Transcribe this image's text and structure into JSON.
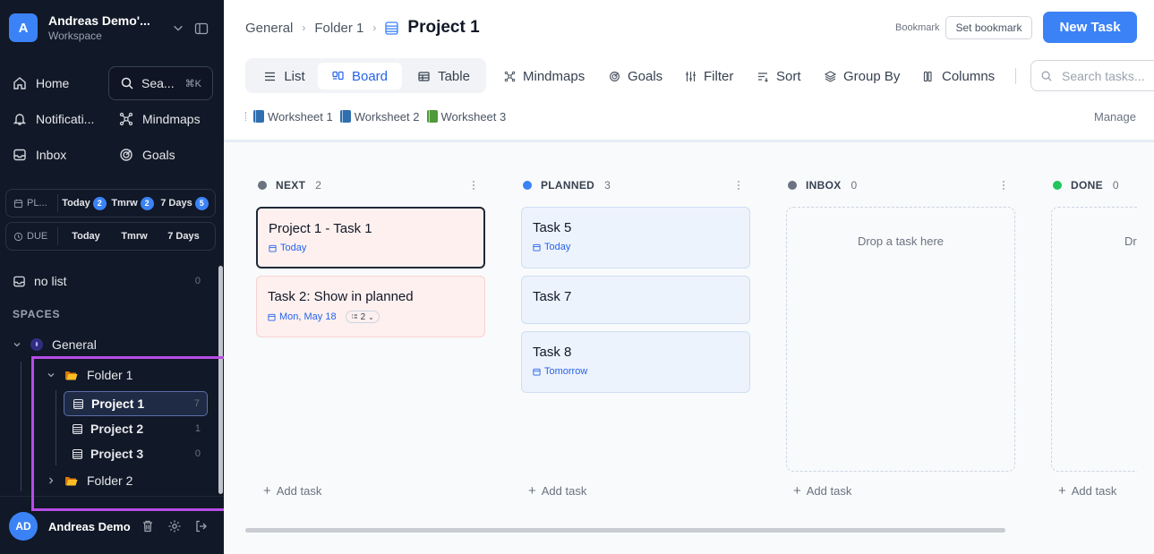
{
  "workspace": {
    "avatar": "A",
    "name": "Andreas Demo'...",
    "subtitle": "Workspace"
  },
  "nav": {
    "home": "Home",
    "search": "Sea...",
    "search_kbd": "⌘K",
    "notifications": "Notificati...",
    "mindmaps": "Mindmaps",
    "inbox": "Inbox",
    "goals": "Goals"
  },
  "planned_row": {
    "label": "PL...",
    "today": "Today",
    "today_count": "2",
    "tmrw": "Tmrw",
    "tmrw_count": "2",
    "week": "7 Days",
    "week_count": "5"
  },
  "due_row": {
    "label": "DUE",
    "today": "Today",
    "tmrw": "Tmrw",
    "week": "7 Days"
  },
  "no_list": {
    "label": "no list",
    "count": "0"
  },
  "spaces_heading": "SPACES",
  "tree": {
    "space": "General",
    "folder1": "Folder 1",
    "projects": [
      {
        "name": "Project 1",
        "count": "7"
      },
      {
        "name": "Project 2",
        "count": "1"
      },
      {
        "name": "Project 3",
        "count": "0"
      }
    ],
    "folder2": "Folder 2"
  },
  "user": {
    "initials": "AD",
    "name": "Andreas Demo"
  },
  "breadcrumb": {
    "space": "General",
    "folder": "Folder 1",
    "current": "Project 1"
  },
  "bookmark": {
    "label": "Bookmark",
    "button": "Set bookmark"
  },
  "new_task": "New Task",
  "views": {
    "list": "List",
    "board": "Board",
    "table": "Table"
  },
  "toolbar": {
    "mindmaps": "Mindmaps",
    "goals": "Goals",
    "filter": "Filter",
    "sort": "Sort",
    "group_by": "Group By",
    "columns": "Columns",
    "search_placeholder": "Search tasks..."
  },
  "worksheets": [
    {
      "name": "Worksheet 1",
      "color": "#2f6fb0"
    },
    {
      "name": "Worksheet 2",
      "color": "#2f6fb0"
    },
    {
      "name": "Worksheet 3",
      "color": "#4f9a3b"
    }
  ],
  "manage": "Manage",
  "columns": [
    {
      "name": "NEXT",
      "count": "2",
      "color": "#6b7280",
      "add": "Add task"
    },
    {
      "name": "PLANNED",
      "count": "3",
      "color": "#3b82f6",
      "add": "Add task"
    },
    {
      "name": "INBOX",
      "count": "0",
      "color": "#6b7280",
      "add": "Add task",
      "drop": "Drop a task here"
    },
    {
      "name": "DONE",
      "count": "0",
      "color": "#22c55e",
      "add": "Add task",
      "drop": "Dro"
    }
  ],
  "cards": {
    "next": [
      {
        "title": "Project 1 - Task 1",
        "date": "Today"
      },
      {
        "title": "Task 2: Show in planned",
        "date": "Mon, May 18",
        "subtasks": "2"
      }
    ],
    "planned": [
      {
        "title": "Task 5",
        "date": "Today"
      },
      {
        "title": "Task 7"
      },
      {
        "title": "Task 8",
        "date": "Tomorrow"
      }
    ]
  }
}
